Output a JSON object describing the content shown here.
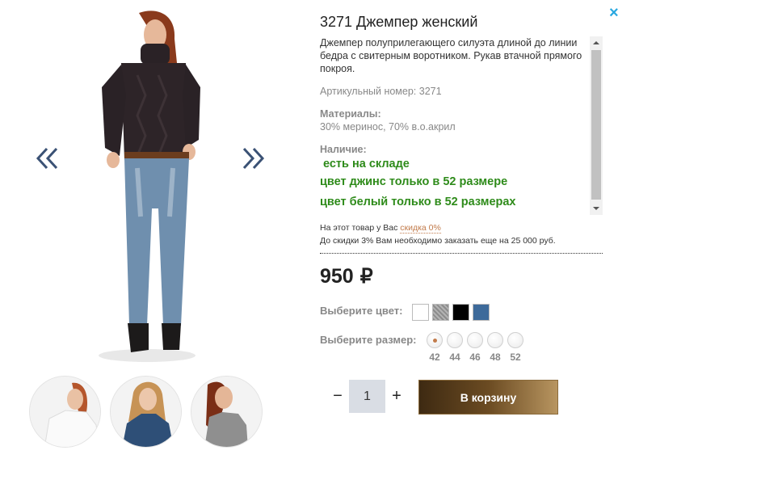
{
  "product": {
    "title": "3271 Джемпер женский",
    "description": "Джемпер полуприлегающего силуэта длиной до линии бедра с свитерным воротником. Рукав втачной прямого покроя.",
    "sku_label": "Артикульный номер: 3271",
    "materials_title": "Материалы:",
    "materials_value": "30% меринос, 70% в.о.акрил",
    "availability_title": "Наличие:",
    "availability_lines": [
      "есть на складе",
      "цвет джинс только в 52 размере",
      "цвет белый только в  52 размерах"
    ]
  },
  "discount": {
    "line1_prefix": "На этот товар у Вас",
    "line1_link": "скидка 0%",
    "line2": "До скидки 3% Вам необходимо заказать еще на 25 000 руб."
  },
  "price": {
    "value": "950",
    "currency": "₽"
  },
  "color_picker": {
    "label": "Выберите цвет:",
    "options": [
      {
        "name": "white",
        "color": "#ffffff"
      },
      {
        "name": "grey-melange",
        "color": "#9a9a9a"
      },
      {
        "name": "black",
        "color": "#000000"
      },
      {
        "name": "blue",
        "color": "#3d6a9a"
      }
    ]
  },
  "size_picker": {
    "label": "Выберите размер:",
    "options": [
      "42",
      "44",
      "46",
      "48",
      "52"
    ],
    "selected": "42"
  },
  "quantity": {
    "value": "1",
    "minus": "−",
    "plus": "+"
  },
  "cart_button": {
    "label": "В корзину"
  },
  "close": {
    "glyph": "×"
  },
  "colors": {
    "accent_link": "#c27b4b",
    "stock_green": "#2e8b1a",
    "close_blue": "#29a8e0"
  },
  "gallery": {
    "prev_icon": "double-chevron-left-icon",
    "next_icon": "double-chevron-right-icon",
    "thumbnails": [
      "white-sweater-thumb",
      "blue-sweater-thumb",
      "grey-sweater-thumb"
    ]
  }
}
